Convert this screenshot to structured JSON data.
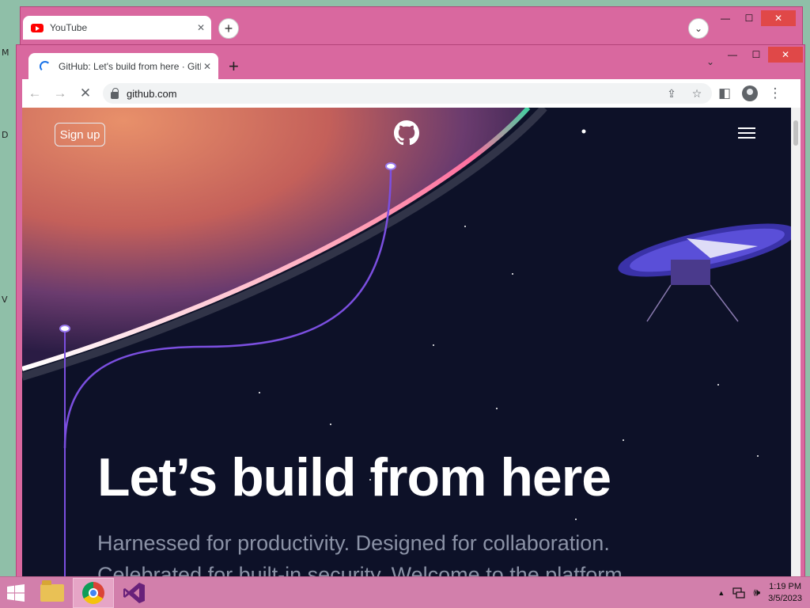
{
  "desktop": {
    "fragments": [
      "M",
      "D",
      "V"
    ]
  },
  "back_window": {
    "tab_title": "YouTube",
    "tab_close": "✕",
    "new_tab": "+",
    "tab_search": "⌄",
    "caption": {
      "minimize": "—",
      "maximize": "☐",
      "close": "✕"
    }
  },
  "browser": {
    "tab_title": "GitHub: Let's build from here · GitHub",
    "tab_close": "✕",
    "new_tab": "+",
    "tab_search": "⌄",
    "caption": {
      "minimize": "—",
      "maximize": "☐",
      "close": "✕"
    },
    "toolbar": {
      "back": "←",
      "forward": "→",
      "stop": "✕",
      "url": "github.com",
      "share": "⇪",
      "bookmark": "☆",
      "side_panel": "◧",
      "menu": "⋮"
    }
  },
  "page": {
    "signup": "Sign up",
    "hero_title": "Let’s build from here",
    "hero_subtitle": "Harnessed for productivity. Designed for collaboration. Celebrated for built-in security. Welcome to the platform"
  },
  "taskbar": {
    "clock_time": "1:19 PM",
    "clock_date": "3/5/2023",
    "tray_arrow": "▲",
    "volume": "🕪"
  },
  "colors": {
    "window_frame": "#d9689f",
    "hero_bg": "#0d1128",
    "taskbar": "#d27fab",
    "accent_line": "#7b4fe0"
  }
}
